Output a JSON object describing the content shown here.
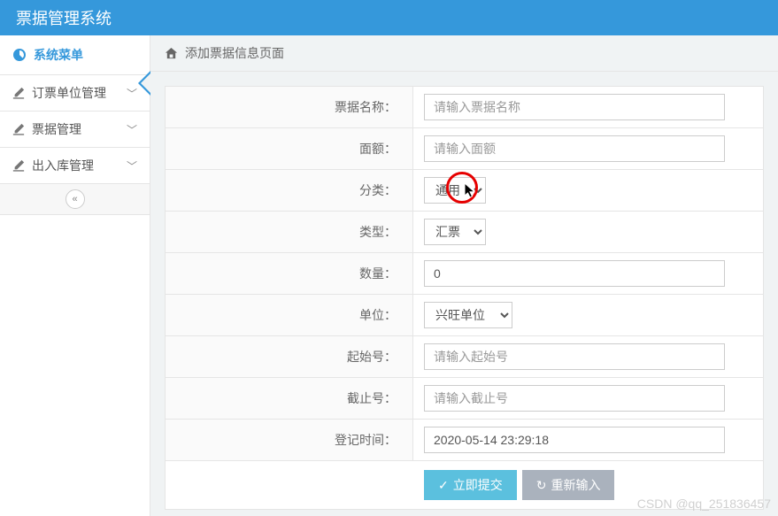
{
  "header": {
    "title": "票据管理系统"
  },
  "sidebar": {
    "heading": "系统菜单",
    "items": [
      {
        "label": "订票单位管理"
      },
      {
        "label": "票据管理"
      },
      {
        "label": "出入库管理"
      }
    ]
  },
  "breadcrumb": {
    "title": "添加票据信息页面"
  },
  "form": {
    "fields": {
      "name": {
        "label": "票据名称：",
        "placeholder": "请输入票据名称",
        "value": ""
      },
      "amount": {
        "label": "面额：",
        "placeholder": "请输入面额",
        "value": ""
      },
      "category": {
        "label": "分类：",
        "selected": "通用"
      },
      "type": {
        "label": "类型：",
        "selected": "汇票"
      },
      "quantity": {
        "label": "数量：",
        "placeholder": "",
        "value": "0"
      },
      "unit": {
        "label": "单位：",
        "selected": "兴旺单位"
      },
      "start": {
        "label": "起始号：",
        "placeholder": "请输入起始号",
        "value": ""
      },
      "end": {
        "label": "截止号：",
        "placeholder": "请输入截止号",
        "value": ""
      },
      "time": {
        "label": "登记时间：",
        "placeholder": "",
        "value": "2020-05-14 23:29:18"
      }
    },
    "buttons": {
      "submit": "立即提交",
      "reset": "重新输入"
    }
  },
  "watermark": "CSDN @qq_251836457"
}
